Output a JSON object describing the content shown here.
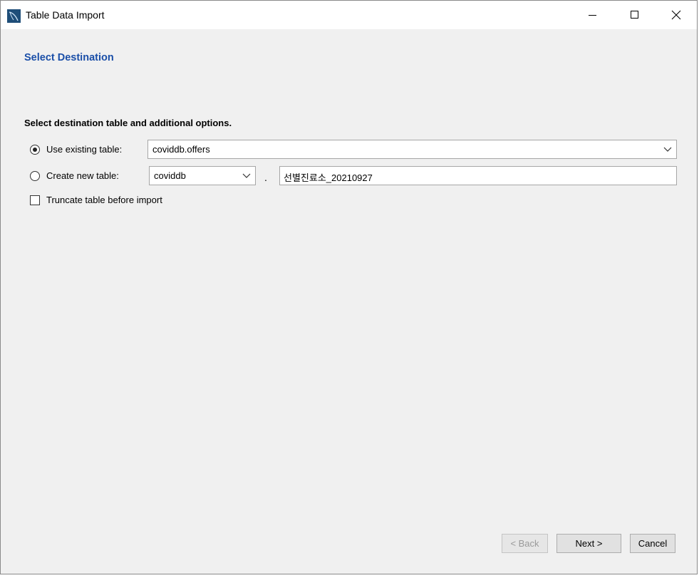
{
  "window": {
    "title": "Table Data Import",
    "controls": {
      "minimize": "minimize-icon",
      "maximize": "maximize-icon",
      "close": "close-icon"
    }
  },
  "page": {
    "heading": "Select Destination",
    "instructions": "Select destination table and additional options."
  },
  "options": {
    "use_existing": {
      "label": "Use existing table:",
      "selected": true,
      "table_value": "coviddb.offers"
    },
    "create_new": {
      "label": "Create new table:",
      "selected": false,
      "schema_value": "coviddb",
      "separator": ".",
      "table_name_value": "선별진료소_20210927"
    },
    "truncate": {
      "label": "Truncate table before import",
      "checked": false
    }
  },
  "buttons": {
    "back": "< Back",
    "next": "Next >",
    "cancel": "Cancel"
  },
  "colors": {
    "heading": "#1b4fa8",
    "window_bg": "#f0f0f0",
    "titlebar_bg": "#ffffff"
  }
}
